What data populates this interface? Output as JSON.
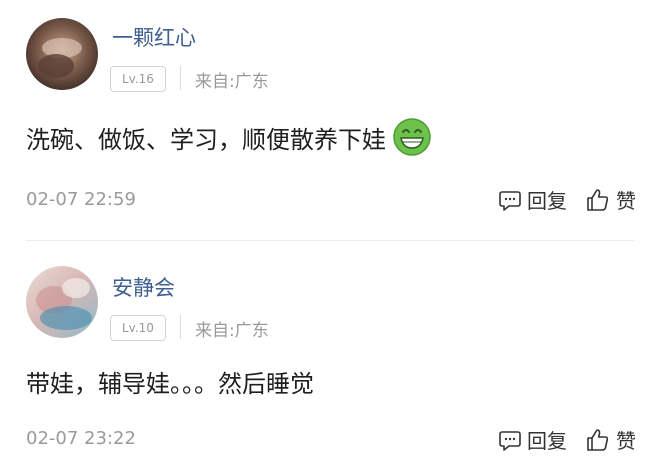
{
  "comments": [
    {
      "username": "一颗红心",
      "level": "Lv.16",
      "location": "来自:广东",
      "content": "洗碗、做饭、学习，顺便散养下娃",
      "emoji": "grinning-face-emoji",
      "time": "02-07 22:59",
      "reply_label": "回复",
      "like_label": "赞"
    },
    {
      "username": "安静会",
      "level": "Lv.10",
      "location": "来自:广东",
      "content": "带娃，辅导娃。。。然后睡觉",
      "time": "02-07 23:22",
      "reply_label": "回复",
      "like_label": "赞"
    }
  ],
  "icons": {
    "reply": "comment-bubble-icon",
    "like": "thumbs-up-icon"
  },
  "colors": {
    "username": "#3f5f8f",
    "meta": "#9a9a9a",
    "emoji": "#6cc24a"
  }
}
